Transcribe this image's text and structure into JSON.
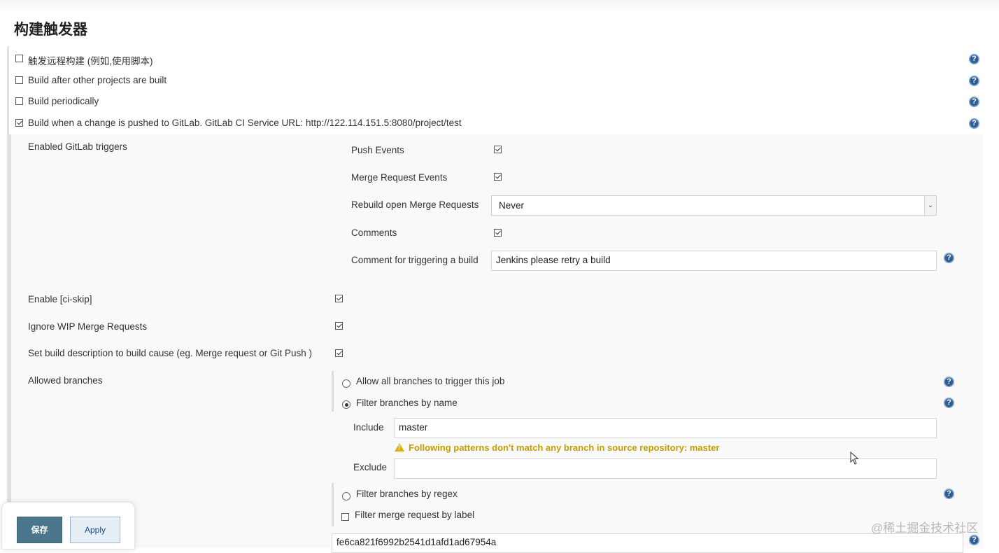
{
  "section": {
    "title": "构建触发器"
  },
  "triggers": [
    {
      "label": "触发远程构建 (例如,使用脚本)",
      "checked": false
    },
    {
      "label": "Build after other projects are built",
      "checked": false
    },
    {
      "label": "Build periodically",
      "checked": false
    },
    {
      "label": "Build when a change is pushed to GitLab. GitLab CI Service URL: http://122.114.151.5:8080/project/test",
      "checked": true
    }
  ],
  "gitlab": {
    "enabled_triggers_label": "Enabled GitLab triggers",
    "push_events": {
      "label": "Push Events",
      "checked": true
    },
    "merge_request_events": {
      "label": "Merge Request Events",
      "checked": true
    },
    "rebuild_open_mr": {
      "label": "Rebuild open Merge Requests",
      "value": "Never"
    },
    "comments": {
      "label": "Comments",
      "checked": true
    },
    "comment_trigger": {
      "label": "Comment for triggering a build",
      "value": "Jenkins please retry a build"
    },
    "ci_skip": {
      "label": "Enable [ci-skip]",
      "checked": true
    },
    "ignore_wip": {
      "label": "Ignore WIP Merge Requests",
      "checked": true
    },
    "set_description": {
      "label": "Set build description to build cause (eg. Merge request or Git Push )",
      "checked": true
    }
  },
  "branches": {
    "label": "Allowed branches",
    "options": [
      {
        "label": "Allow all branches to trigger this job",
        "selected": false
      },
      {
        "label": "Filter branches by name",
        "selected": true
      }
    ],
    "include_label": "Include",
    "include_value": "master",
    "warning": "Following patterns don't match any branch in source repository: master",
    "exclude_label": "Exclude",
    "exclude_value": "",
    "regex_option": {
      "label": "Filter branches by regex",
      "selected": false
    },
    "label_filter": {
      "label": "Filter merge request by label",
      "checked": false
    }
  },
  "secret_token_value": "fe6ca821f6992b2541d1afd1ad67954a",
  "buttons": {
    "save": "保存",
    "apply": "Apply"
  },
  "help_glyph": "?",
  "watermark": "@稀土掘金技术社区",
  "colors": {
    "help_icon": "#2f5f97",
    "save_button": "#4b758b",
    "warning": "#c29d00"
  }
}
